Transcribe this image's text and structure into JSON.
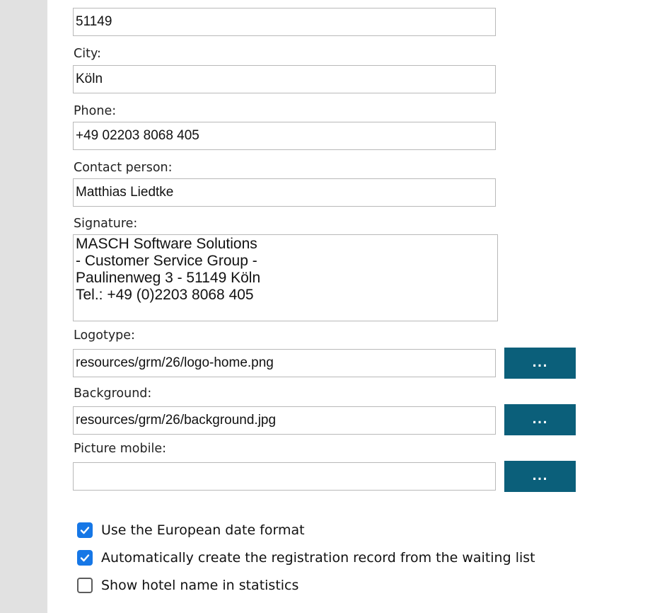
{
  "form": {
    "zip": {
      "value": "51149"
    },
    "city": {
      "label": "City:",
      "value": "Köln"
    },
    "phone": {
      "label": "Phone:",
      "value": "+49 02203 8068 405"
    },
    "contact": {
      "label": "Contact person:",
      "value": "Matthias Liedtke"
    },
    "signature": {
      "label": "Signature:",
      "value": "MASCH Software Solutions\n- Customer Service Group -\nPaulinenweg 3 - 51149 Köln\nTel.: +49 (0)2203 8068 405"
    },
    "logotype": {
      "label": "Logotype:",
      "value": "resources/grm/26/logo-home.png",
      "browse_label": "..."
    },
    "background": {
      "label": "Background:",
      "value": "resources/grm/26/background.jpg",
      "browse_label": "..."
    },
    "picture_mobile": {
      "label": "Picture mobile:",
      "value": "",
      "browse_label": "..."
    }
  },
  "options": [
    {
      "label": "Use the European date format",
      "checked": true
    },
    {
      "label": "Automatically create the registration record from the waiting list",
      "checked": true
    },
    {
      "label": "Show hotel name in statistics",
      "checked": false
    }
  ],
  "colors": {
    "button": "#0b5f7a",
    "checkbox_checked": "#1677e6",
    "sidebar": "#e1e1e1"
  }
}
